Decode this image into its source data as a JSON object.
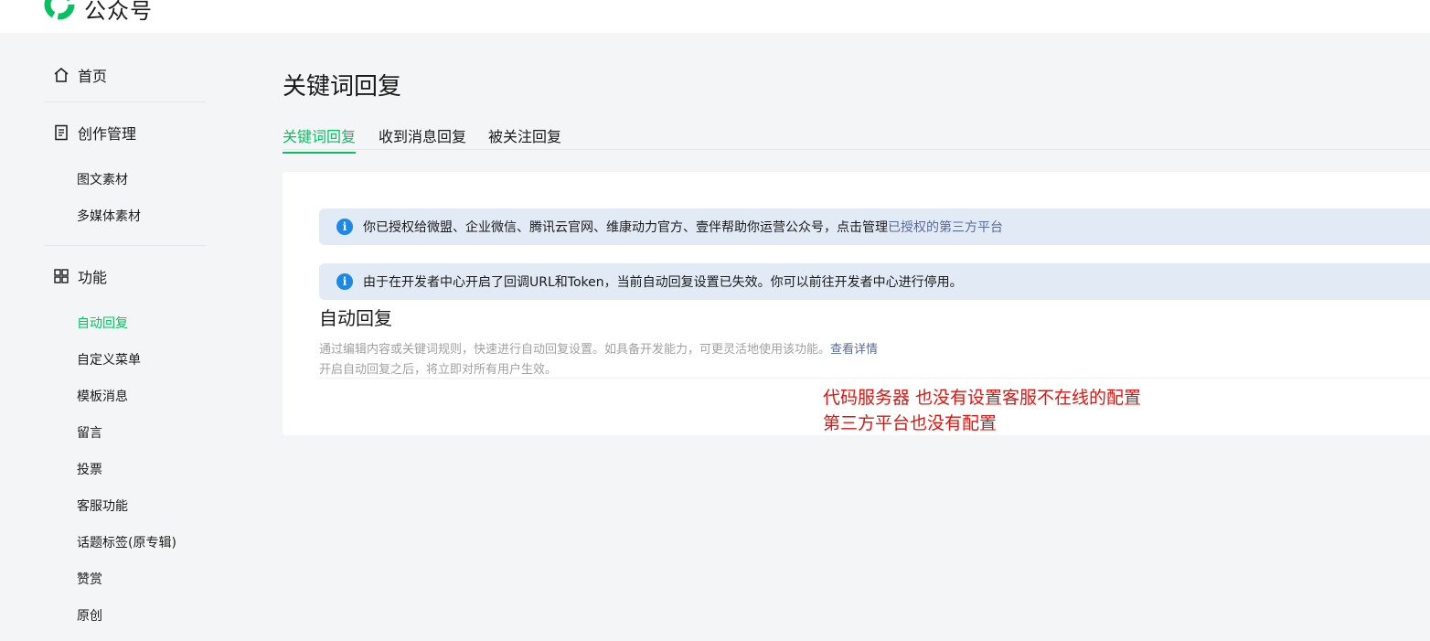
{
  "header": {
    "brand_text": "公众号"
  },
  "sidebar": {
    "home_label": "首页",
    "creation_label": "创作管理",
    "creation_items": [
      "图文素材",
      "多媒体素材"
    ],
    "features_label": "功能",
    "feature_items": [
      "自动回复",
      "自定义菜单",
      "模板消息",
      "留言",
      "投票",
      "客服功能",
      "话题标签(原专辑)",
      "赞赏",
      "原创"
    ],
    "active_item": "自动回复"
  },
  "main": {
    "title": "关键词回复",
    "tabs": [
      "关键词回复",
      "收到消息回复",
      "被关注回复"
    ],
    "active_tab": "关键词回复",
    "notice1": {
      "text": "你已授权给微盟、企业微信、腾讯云官网、维康动力官方、壹伴帮助你运营公众号，点击管理",
      "link": "已授权的第三方平台"
    },
    "notice2": {
      "text": "由于在开发者中心开启了回调URL和Token，当前自动回复设置已失效。你可以前往开发者中心进行停用。"
    },
    "section_title": "自动回复",
    "desc_line1": "通过编辑内容或关键词规则，快速进行自动回复设置。如具备开发能力，可更灵活地使用该功能。",
    "desc_line1_link": "查看详情",
    "desc_line2": "开启自动回复之后，将立即对所有用户生效。"
  },
  "annotation": {
    "line1": "代码服务器 也没有设置客服不在线的配置",
    "line2": "第三方平台也没有配置"
  },
  "colors": {
    "accent": "#07c160",
    "link": "#576b95",
    "info": "#1e88e5",
    "annotation": "#e0140f"
  }
}
